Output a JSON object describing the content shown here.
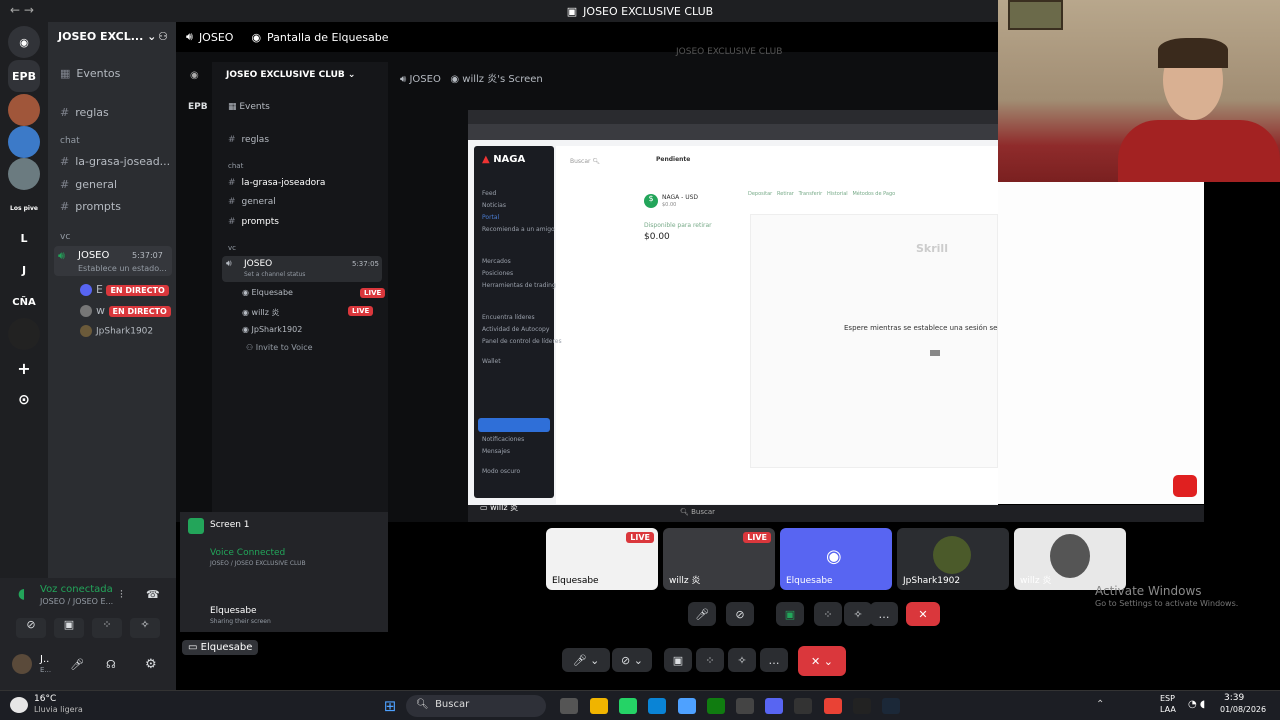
{
  "titlebar": {
    "title": "JOSEO EXCLUSIVE CLUB"
  },
  "rail": {
    "items": [
      "EPB",
      "L",
      "J",
      "CÑA"
    ],
    "lospive": "Los pive"
  },
  "server": {
    "name": "JOSEO EXCL...",
    "events": "Eventos",
    "channels": [
      "reglas",
      "la-grasa-josead...",
      "general",
      "prompts"
    ],
    "cat_chat": "chat",
    "cat_vc": "vc",
    "voice_channel": "JOSEO",
    "voice_timer": "5:37:07",
    "voice_status": "Establece un estado...",
    "members": [
      {
        "name": "E",
        "badge": "EN DIRECTO"
      },
      {
        "name": "w",
        "badge": "EN DIRECTO"
      },
      {
        "name": "JpShark1902",
        "badge": ""
      }
    ]
  },
  "header": {
    "channel": "JOSEO",
    "screen": "Pantalla de Elquesabe"
  },
  "stream": {
    "watermark": "JOSEO EXCLUSIVE CLUB",
    "server_name": "JOSEO EXCLUSIVE CLUB",
    "rail_label": "EPB",
    "inner_channel": "JOSEO",
    "inner_screen": "willz 炎's Screen",
    "events": "Events",
    "channels": [
      "reglas",
      "la-grasa-joseadora",
      "general",
      "prompts"
    ],
    "cat_chat": "chat",
    "cat_vc": "vc",
    "vc": "JOSEO",
    "vc_timer": "5:37:05",
    "vc_status": "Set a channel status",
    "members": [
      "Elquesabe",
      "willz 炎",
      "JpShark1902"
    ],
    "live": "LIVE",
    "invite": "Invite to Voice",
    "screen1": "Screen 1",
    "voice_connected": "Voice Connected",
    "voice_sub": "JOSEO / JOSEO EXCLUSIVE CLUB",
    "user": "Elquesabe",
    "user_sub": "Sharing their screen",
    "share_label": "willz 炎",
    "taskbar_search": "Buscar"
  },
  "naga": {
    "brand": "NAGA",
    "search": "Buscar",
    "pending": "Pendiente",
    "account": "NAGA - USD",
    "account_sub": "$0.00",
    "available_label": "Disponible para retirar",
    "balance": "$0.00",
    "tabs": [
      "Depositar",
      "Retirar",
      "Transferir",
      "Historial",
      "Métodos de Pago"
    ],
    "waiting": "Espere mientras se establece una sesión segura...",
    "method": "Skrill",
    "menu": [
      "Feed",
      "Noticias",
      "Portal",
      "Recomienda a un amigo",
      "Mercados",
      "Posiciones",
      "Herramientas de trading",
      "Encuentra líderes",
      "Actividad de Autocopy",
      "Panel de control de líderes",
      "Wallet",
      "Notificaciones",
      "Mensajes",
      "Modo oscuro"
    ]
  },
  "tiles": [
    {
      "name": "Elquesabe",
      "live": "LIVE"
    },
    {
      "name": "willz 炎",
      "live": "LIVE"
    },
    {
      "name": "Elquesabe",
      "live": ""
    },
    {
      "name": "JpShark1902",
      "live": ""
    },
    {
      "name": "willz 炎",
      "live": ""
    }
  ],
  "watching": "Elquesabe",
  "activate": {
    "title": "Activate Windows",
    "sub": "Go to Settings to activate Windows."
  },
  "voice_bottom": {
    "status": "Voz conectada",
    "sub": "JOSEO / JOSEO E...",
    "user": "J..",
    "user_sub": "E..."
  },
  "windows": {
    "temp": "16°C",
    "weather": "Lluvia ligera",
    "search": "Buscar",
    "lang": "ESP",
    "region": "LAA",
    "time": "3:39",
    "date": "01/08/2026"
  },
  "colors": {
    "live": "#da373c",
    "green": "#23a55a",
    "blurple": "#5865f2"
  }
}
